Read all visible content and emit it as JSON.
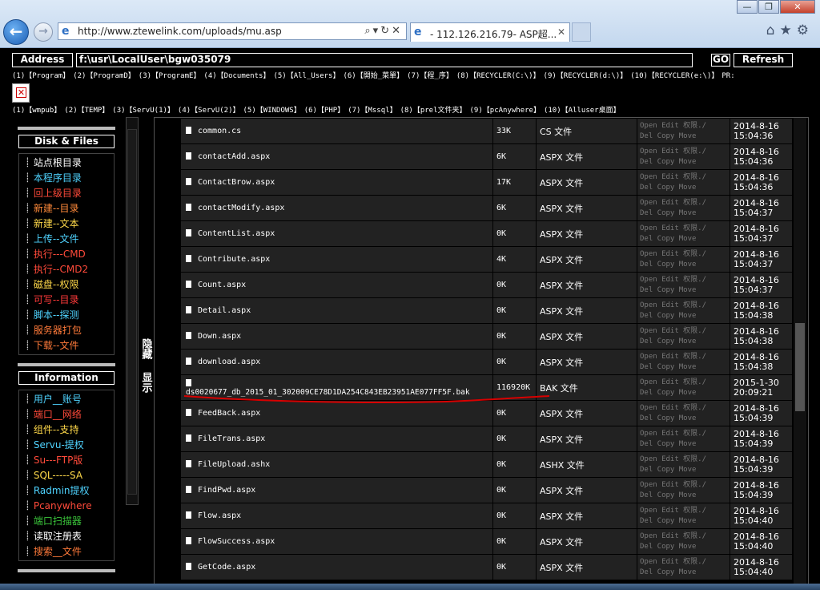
{
  "browser": {
    "url": "http://www.ztewelink.com/uploads/mu.asp",
    "tab_title": "- 112.126.216.79- ASP超...",
    "address_icon": "ie-icon",
    "window_controls": [
      "—",
      "❐",
      "✕"
    ]
  },
  "shell": {
    "address_label": "Address",
    "address_value": "f:\\usr\\LocalUser\\bgw035079",
    "go_label": "GO",
    "refresh_label": "Refresh",
    "quick_row1": [
      "(1)【Program】",
      "(2)【ProgramD】",
      "(3)【ProgramE】",
      "(4)【Documents】",
      "(5)【All_Users】",
      "(6)【開始_菜單】",
      "(7)【程_序】",
      "(8)【RECYCLER(C:\\)】",
      "(9)【RECYCLER(d:\\)】",
      "(10)【RECYCLER(e:\\)】",
      "PR:"
    ],
    "quick_row2": [
      "(1)【wmpub】",
      "(2)【TEMP】",
      "(3)【ServU(1)】",
      "(4)【ServU(2)】",
      "(5)【WINDOWS】",
      "(6)【PHP】",
      "(7)【Mssql】",
      "(8)【prel文件夹】",
      "(9)【pcAnywhere】",
      "(10)【Alluser桌面】"
    ]
  },
  "sidebar": {
    "disk_title": "Disk & Files",
    "disk_items": [
      {
        "label": "站点根目录",
        "color": "#ffffff"
      },
      {
        "label": "本程序目录",
        "color": "#4fd3ff"
      },
      {
        "label": "回上级目录",
        "color": "#ff4a3a"
      },
      {
        "label": "新建--目录",
        "color": "#ff8a3a"
      },
      {
        "label": "新建--文本",
        "color": "#ffd94a"
      },
      {
        "label": "上传--文件",
        "color": "#4fd3ff"
      },
      {
        "label": "执行---CMD",
        "color": "#ff4a3a"
      },
      {
        "label": "执行--CMD2",
        "color": "#ff4a3a"
      },
      {
        "label": "磁盘--权限",
        "color": "#ffd94a"
      },
      {
        "label": "可写--目录",
        "color": "#ff3a3a"
      },
      {
        "label": "脚本--探测",
        "color": "#4fd3ff"
      },
      {
        "label": "服务器打包",
        "color": "#ff7a3a"
      },
      {
        "label": "下载--文件",
        "color": "#ff7a3a"
      }
    ],
    "info_title": "Information",
    "info_items": [
      {
        "label": "用户__账号",
        "color": "#4fd3ff"
      },
      {
        "label": "端口__网络",
        "color": "#ff4a3a"
      },
      {
        "label": "组件--支持",
        "color": "#ffd94a"
      },
      {
        "label": "Servu-提权",
        "color": "#4fd3ff"
      },
      {
        "label": "Su---FTP版",
        "color": "#ff4a3a"
      },
      {
        "label": "SQL-----SA",
        "color": "#ffd94a"
      },
      {
        "label": "Radmin提权",
        "color": "#4fd3ff"
      },
      {
        "label": "Pcanywhere",
        "color": "#ff4a3a"
      },
      {
        "label": "端口扫描器",
        "color": "#3ac43a"
      },
      {
        "label": "读取注册表",
        "color": "#ffffff"
      },
      {
        "label": "搜索__文件",
        "color": "#ff7a3a"
      }
    ],
    "toggle_hide": "隐藏",
    "toggle_show": "显示"
  },
  "files": {
    "actions_line1": "Open Edit 权限./",
    "actions_line2": "Del Copy Move",
    "rows": [
      {
        "name": "common.cs",
        "size": "33K",
        "type": "CS 文件",
        "date": "2014-8-16",
        "time": "15:04:36"
      },
      {
        "name": "contactAdd.aspx",
        "size": "6K",
        "type": "ASPX 文件",
        "date": "2014-8-16",
        "time": "15:04:36"
      },
      {
        "name": "ContactBrow.aspx",
        "size": "17K",
        "type": "ASPX 文件",
        "date": "2014-8-16",
        "time": "15:04:36"
      },
      {
        "name": "contactModify.aspx",
        "size": "6K",
        "type": "ASPX 文件",
        "date": "2014-8-16",
        "time": "15:04:37"
      },
      {
        "name": "ContentList.aspx",
        "size": "0K",
        "type": "ASPX 文件",
        "date": "2014-8-16",
        "time": "15:04:37"
      },
      {
        "name": "Contribute.aspx",
        "size": "4K",
        "type": "ASPX 文件",
        "date": "2014-8-16",
        "time": "15:04:37"
      },
      {
        "name": "Count.aspx",
        "size": "0K",
        "type": "ASPX 文件",
        "date": "2014-8-16",
        "time": "15:04:37"
      },
      {
        "name": "Detail.aspx",
        "size": "0K",
        "type": "ASPX 文件",
        "date": "2014-8-16",
        "time": "15:04:38"
      },
      {
        "name": "Down.aspx",
        "size": "0K",
        "type": "ASPX 文件",
        "date": "2014-8-16",
        "time": "15:04:38"
      },
      {
        "name": "download.aspx",
        "size": "0K",
        "type": "ASPX 文件",
        "date": "2014-8-16",
        "time": "15:04:38"
      },
      {
        "name": "ds0020677_db_2015_01_302009CE78D1DA254C843EB23951AE077FF5F.bak",
        "size": "116920K",
        "type": "BAK 文件",
        "date": "2015-1-30",
        "time": "20:09:21"
      },
      {
        "name": "FeedBack.aspx",
        "size": "0K",
        "type": "ASPX 文件",
        "date": "2014-8-16",
        "time": "15:04:39"
      },
      {
        "name": "FileTrans.aspx",
        "size": "0K",
        "type": "ASPX 文件",
        "date": "2014-8-16",
        "time": "15:04:39"
      },
      {
        "name": "FileUpload.ashx",
        "size": "0K",
        "type": "ASHX 文件",
        "date": "2014-8-16",
        "time": "15:04:39"
      },
      {
        "name": "FindPwd.aspx",
        "size": "0K",
        "type": "ASPX 文件",
        "date": "2014-8-16",
        "time": "15:04:39"
      },
      {
        "name": "Flow.aspx",
        "size": "0K",
        "type": "ASPX 文件",
        "date": "2014-8-16",
        "time": "15:04:40"
      },
      {
        "name": "FlowSuccess.aspx",
        "size": "0K",
        "type": "ASPX 文件",
        "date": "2014-8-16",
        "time": "15:04:40"
      },
      {
        "name": "GetCode.aspx",
        "size": "0K",
        "type": "ASPX 文件",
        "date": "2014-8-16",
        "time": "15:04:40"
      }
    ]
  }
}
